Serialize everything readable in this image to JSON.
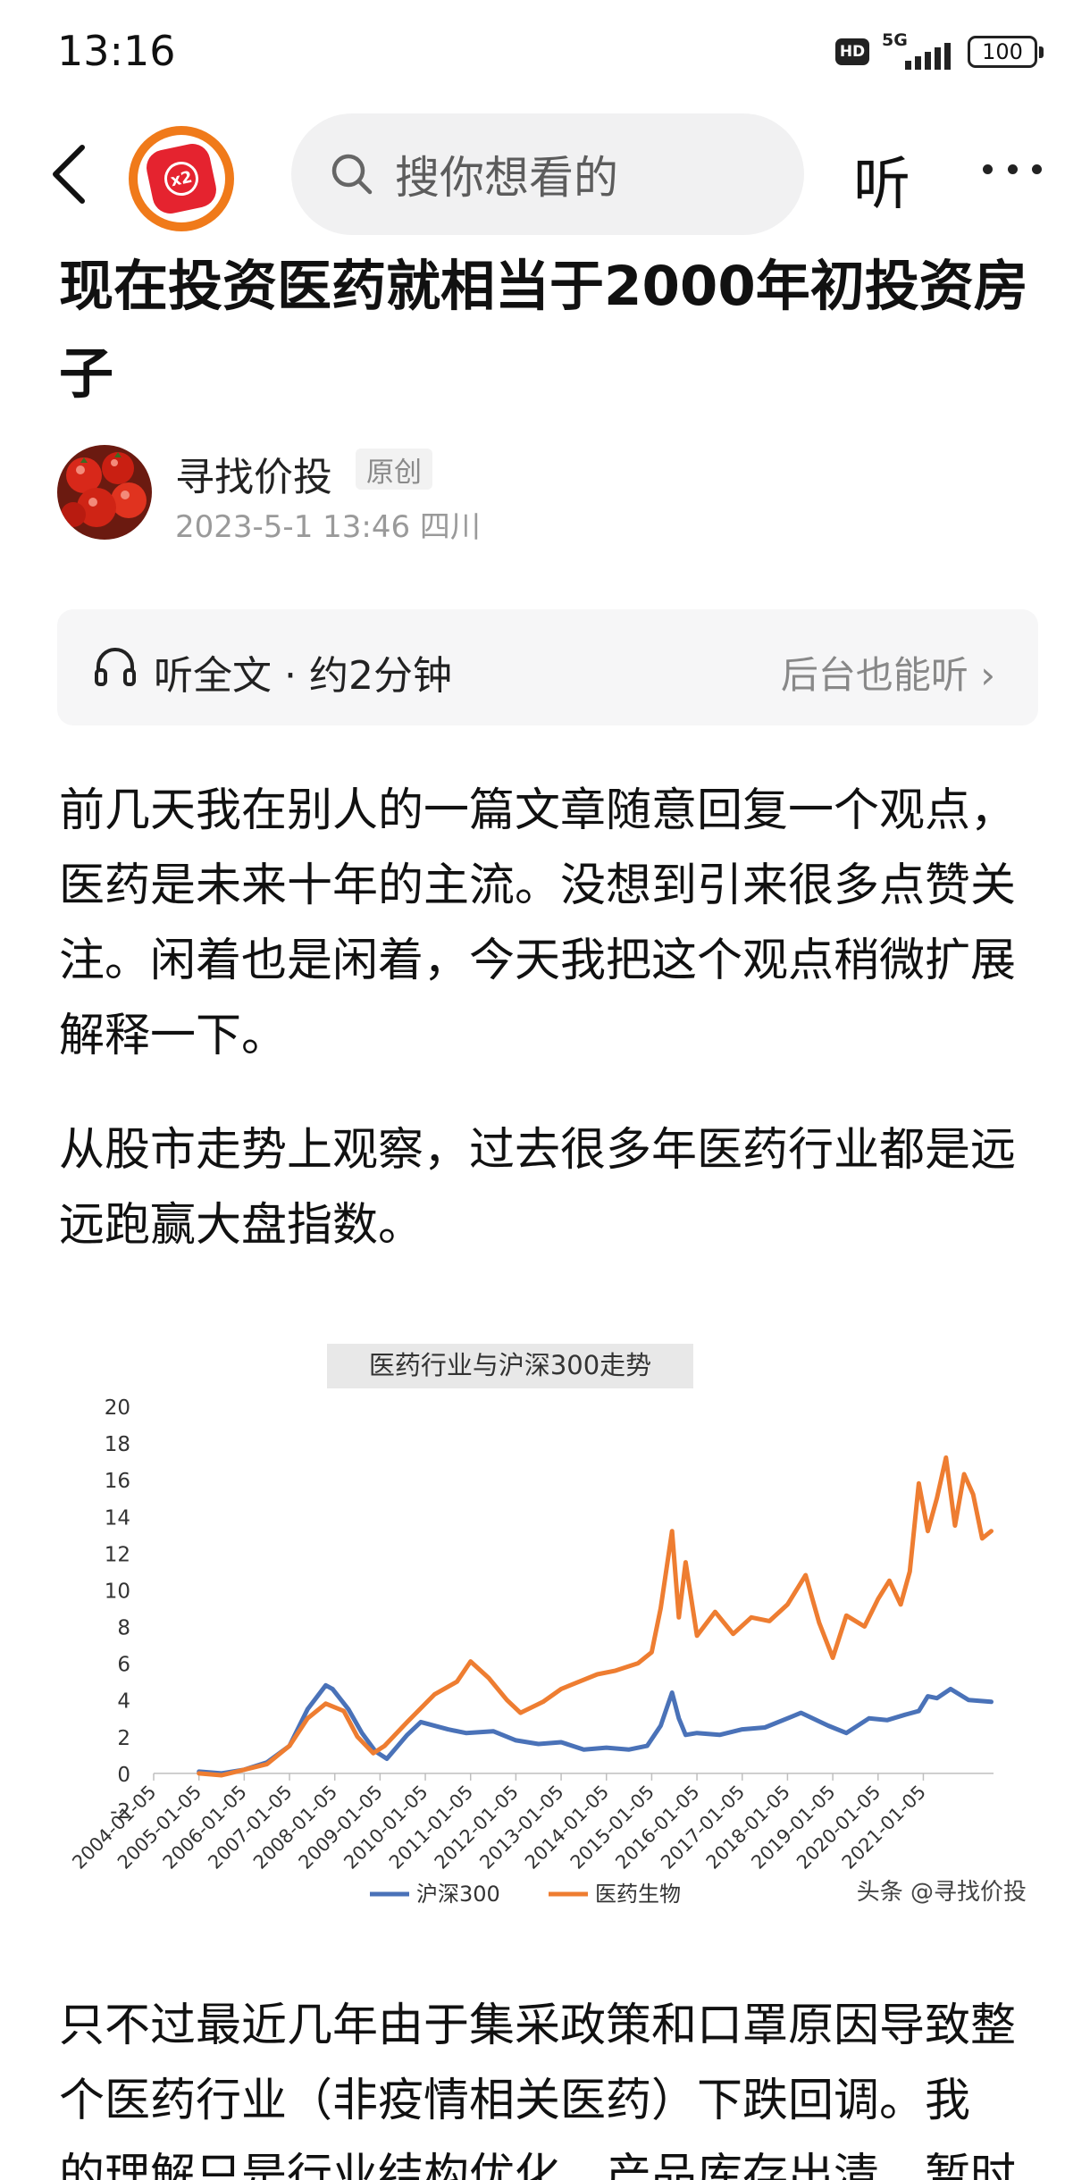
{
  "status_bar": {
    "time": "13:16",
    "hd_label": "HD",
    "network_label": "5G",
    "battery_level": "100"
  },
  "nav": {
    "back_icon": "back-arrow-icon",
    "logo_badge": "x2",
    "search_placeholder": "搜你想看的",
    "listen_label": "听",
    "more_icon": "more-dots-icon"
  },
  "article": {
    "title": "现在投资医药就相当于2000年初投资房子",
    "author_name": "寻找价投",
    "original_tag": "原创",
    "meta": "2023-5-1  13:46  四川",
    "listen_panel": {
      "label": "听全文 · 约2分钟",
      "background_label": "后台也能听",
      "chevron": "›"
    },
    "paragraphs": [
      "前几天我在别人的一篇文章随意回复一个观点，医药是未来十年的主流。没想到引来很多点赞关注。闲着也是闲着，今天我把这个观点稍微扩展解释一下。",
      "从股市走势上观察，过去很多年医药行业都是远远跑赢大盘指数。",
      "只不过最近几年由于集采政策和口罩原因导致整个医药行业（非疫情相关医药）下跌回调。我"
    ],
    "cut_line": "的理解只是行业结构优化，产品库存出清，暂时"
  },
  "chart_data": {
    "type": "line",
    "title": "医药行业与沪深300走势",
    "watermark": "头条 @寻找价投",
    "ylim": [
      -2,
      20
    ],
    "yticks": [
      "-2",
      "0",
      "2",
      "4",
      "6",
      "8",
      "10",
      "12",
      "14",
      "16",
      "18",
      "20"
    ],
    "ytick_values": [
      -2,
      0,
      2,
      4,
      6,
      8,
      10,
      12,
      14,
      16,
      18,
      20
    ],
    "x_range": [
      2004.0,
      2022.55
    ],
    "xticks": [
      "2004-01-05",
      "2005-01-05",
      "2006-01-05",
      "2007-01-05",
      "2008-01-05",
      "2009-01-05",
      "2010-01-05",
      "2011-01-05",
      "2012-01-05",
      "2013-01-05",
      "2014-01-05",
      "2015-01-05",
      "2016-01-05",
      "2017-01-05",
      "2018-01-05",
      "2019-01-05",
      "2020-01-05",
      "2021-01-05"
    ],
    "xtick_values": [
      2004,
      2005,
      2006,
      2007,
      2008,
      2009,
      2010,
      2011,
      2012,
      2013,
      2014,
      2015,
      2016,
      2017,
      2018,
      2019,
      2020,
      2021
    ],
    "grid": false,
    "legend_position": "bottom",
    "series": [
      {
        "name": "沪深300",
        "color": "#4a72b8",
        "x": [
          2005.0,
          2005.5,
          2006.0,
          2006.5,
          2007.0,
          2007.4,
          2007.8,
          2007.95,
          2008.3,
          2008.6,
          2008.9,
          2009.15,
          2009.6,
          2009.9,
          2010.5,
          2010.9,
          2011.5,
          2012.0,
          2012.5,
          2013.0,
          2013.5,
          2014.0,
          2014.5,
          2014.9,
          2015.2,
          2015.45,
          2015.6,
          2015.75,
          2016.0,
          2016.5,
          2017.0,
          2017.5,
          2018.0,
          2018.3,
          2018.9,
          2019.3,
          2019.8,
          2020.2,
          2020.6,
          2020.9,
          2021.1,
          2021.3,
          2021.6,
          2022.0,
          2022.5
        ],
        "values": [
          0.1,
          0.0,
          0.2,
          0.6,
          1.5,
          3.5,
          4.8,
          4.6,
          3.5,
          2.2,
          1.2,
          0.8,
          2.1,
          2.8,
          2.4,
          2.2,
          2.3,
          1.8,
          1.6,
          1.7,
          1.3,
          1.4,
          1.3,
          1.5,
          2.6,
          4.4,
          3.0,
          2.1,
          2.2,
          2.1,
          2.4,
          2.5,
          3.0,
          3.3,
          2.6,
          2.2,
          3.0,
          2.9,
          3.2,
          3.4,
          4.2,
          4.1,
          4.6,
          4.0,
          3.9
        ]
      },
      {
        "name": "医药生物",
        "color": "#ee7d31",
        "x": [
          2005.0,
          2005.5,
          2006.0,
          2006.5,
          2007.0,
          2007.4,
          2007.8,
          2008.2,
          2008.5,
          2008.85,
          2009.1,
          2009.6,
          2010.2,
          2010.7,
          2011.0,
          2011.4,
          2011.8,
          2012.1,
          2012.6,
          2013.0,
          2013.4,
          2013.8,
          2014.2,
          2014.7,
          2015.0,
          2015.2,
          2015.45,
          2015.6,
          2015.75,
          2016.0,
          2016.4,
          2016.8,
          2017.2,
          2017.6,
          2018.0,
          2018.4,
          2018.7,
          2019.0,
          2019.3,
          2019.7,
          2020.0,
          2020.25,
          2020.5,
          2020.7,
          2020.9,
          2021.1,
          2021.3,
          2021.5,
          2021.7,
          2021.9,
          2022.1,
          2022.3,
          2022.5
        ],
        "values": [
          0.0,
          -0.1,
          0.2,
          0.5,
          1.5,
          3.0,
          3.8,
          3.4,
          2.0,
          1.1,
          1.5,
          2.8,
          4.3,
          5.0,
          6.1,
          5.2,
          4.0,
          3.3,
          3.9,
          4.6,
          5.0,
          5.4,
          5.6,
          6.0,
          6.6,
          9.0,
          13.2,
          8.5,
          11.5,
          7.5,
          8.8,
          7.6,
          8.5,
          8.3,
          9.2,
          10.8,
          8.2,
          6.3,
          8.6,
          8.0,
          9.5,
          10.5,
          9.2,
          11.0,
          15.8,
          13.2,
          15.0,
          17.2,
          13.5,
          16.3,
          15.2,
          12.8,
          13.2
        ]
      }
    ]
  }
}
